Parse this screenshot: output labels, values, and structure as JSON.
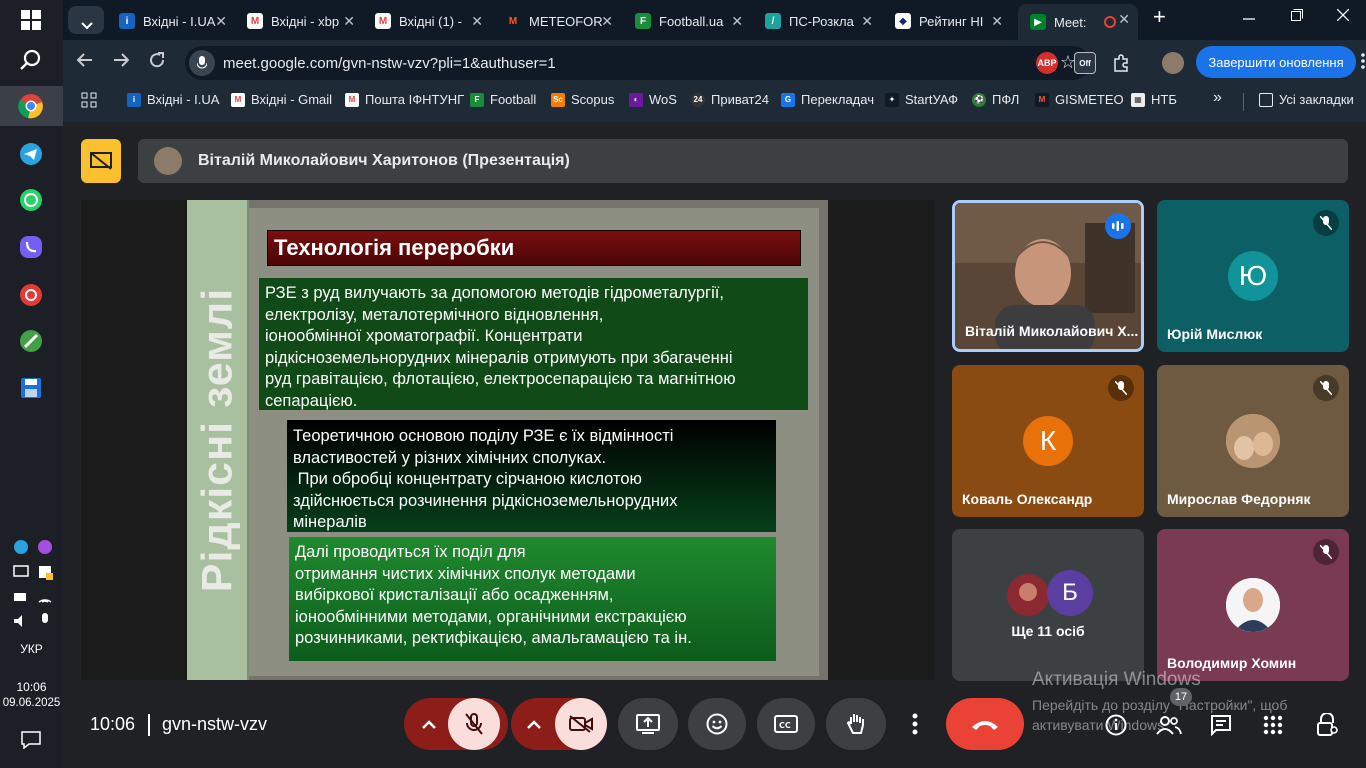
{
  "colors": {
    "accent": "#1a73e8",
    "meet_bg": "#202124",
    "end_call": "#ea4335",
    "presenting": "#fbc02d"
  },
  "taskbar": {
    "start_icon": "windows-icon",
    "lang": "УКР",
    "clock_time": "10:06",
    "clock_date": "09.06.2025"
  },
  "tabs": [
    {
      "title": "Вхідні - I.UA",
      "icon": "i-ua-icon"
    },
    {
      "title": "Вхідні - xbp",
      "icon": "gmail-icon"
    },
    {
      "title": "Вхідні (1) -",
      "icon": "gmail-icon"
    },
    {
      "title": "METEOFOR",
      "icon": "meteofor-icon"
    },
    {
      "title": "Football.ua",
      "icon": "football-icon"
    },
    {
      "title": "ПС-Розкла",
      "icon": "ps-icon"
    },
    {
      "title": "Рейтинг НІ",
      "icon": "rating-icon"
    },
    {
      "title": "Meet: ",
      "icon": "meet-icon"
    }
  ],
  "omnibox": {
    "url": "meet.google.com/gvn-nstw-vzv?pli=1&authuser=1"
  },
  "extensions": {
    "abp": "ABP",
    "off": "Off"
  },
  "update_button": "Завершити оновлення",
  "bookmarks": [
    {
      "label": "Вхідні - I.UA",
      "icon": "i-ua-icon"
    },
    {
      "label": "Вхідні - Gmail",
      "icon": "gmail-icon"
    },
    {
      "label": "Пошта ІФНТУНГ",
      "icon": "gmail-icon"
    },
    {
      "label": "Football",
      "icon": "football-icon"
    },
    {
      "label": "Scopus",
      "icon": "scopus-icon"
    },
    {
      "label": "WoS",
      "icon": "wos-icon"
    },
    {
      "label": "Приват24",
      "icon": "privat24-icon"
    },
    {
      "label": "Перекладач",
      "icon": "translate-icon"
    },
    {
      "label": "StartУАФ",
      "icon": "startuaf-icon"
    },
    {
      "label": "ПФЛ",
      "icon": "pfl-icon"
    },
    {
      "label": "GISMETEO",
      "icon": "gismeteo-icon"
    },
    {
      "label": "НТБ",
      "icon": "ntb-icon"
    }
  ],
  "all_bookmarks": "Усі закладки",
  "presenter_bar": "Віталій Миколайович Харитонов (Презентація)",
  "slide": {
    "side_title": "Рідкісні землі",
    "heading": "Технологія переробки",
    "box1": [
      "РЗЕ з руд вилучають за допомогою методів гідрометалургії,",
      "електролізу, металотермічного відновлення,",
      "іонообмінної хроматографії. Концентрати",
      "рідкісноземельнорудних мінералів отримують при збагаченні",
      "руд гравітацією, флотацією, електросепарацією та магнітною",
      "сепарацією."
    ],
    "box2": [
      "Теоретичною основою поділу РЗЕ є їх відмінності",
      "властивостей у різних хімічних сполуках.",
      " При обробці концентрату сірчаною кислотою",
      "здійснюється розчинення рідкісноземельнорудних",
      "мінералів"
    ],
    "box3": [
      "Далі проводиться їх поділ для",
      "отримання чистих хімічних сполук методами",
      "вибіркової кристалізації або осадженням,",
      "іонообмінними методами, органічними екстракцією",
      "розчинниками, ректифікацією, амальгамацією та ін."
    ]
  },
  "participants": [
    {
      "name": "Віталій Миколайович Х...",
      "kind": "video"
    },
    {
      "name": "Юрій Мислюк",
      "letter": "Ю",
      "color": "#12939a"
    },
    {
      "name": "Коваль Олександр",
      "letter": "К",
      "color": "#e8710a"
    },
    {
      "name": "Мирослав Федорняк",
      "kind": "photo"
    },
    {
      "name": "Ще 11 осіб",
      "letter": "Б",
      "color": "#5b3fa0"
    },
    {
      "name": "Володимир Хомин",
      "kind": "photo"
    }
  ],
  "watermark": {
    "title": "Активація Windows",
    "body": "Перейдіть до розділу \"Настройки\", щоб активувати Windows."
  },
  "meeting": {
    "time": "10:06",
    "code": "gvn-nstw-vzv",
    "people_count": "17"
  }
}
